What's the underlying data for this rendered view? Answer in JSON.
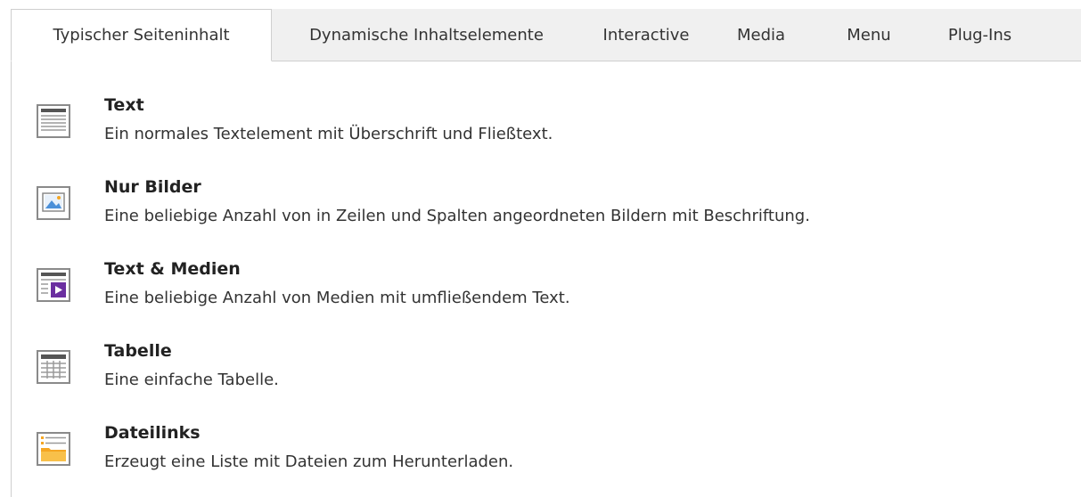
{
  "tabs": [
    {
      "label": "Typischer Seiteninhalt",
      "active": true
    },
    {
      "label": "Dynamische Inhaltselemente",
      "active": false
    },
    {
      "label": "Interactive",
      "active": false
    },
    {
      "label": "Media",
      "active": false
    },
    {
      "label": "Menu",
      "active": false
    },
    {
      "label": "Plug-Ins",
      "active": false
    }
  ],
  "items": [
    {
      "icon": "text-icon",
      "title": "Text",
      "description": "Ein normales Textelement mit Überschrift und Fließtext."
    },
    {
      "icon": "images-icon",
      "title": "Nur Bilder",
      "description": "Eine beliebige Anzahl von in Zeilen und Spalten angeordneten Bildern mit Beschriftung."
    },
    {
      "icon": "text-media-icon",
      "title": "Text & Medien",
      "description": "Eine beliebige Anzahl von Medien mit umfließendem Text."
    },
    {
      "icon": "table-icon",
      "title": "Tabelle",
      "description": "Eine einfache Tabelle."
    },
    {
      "icon": "filelinks-icon",
      "title": "Dateilinks",
      "description": "Erzeugt eine Liste mit Dateien zum Herunterladen."
    }
  ],
  "colors": {
    "icon_gray": "#8a8a8a",
    "sky_blue": "#4a90d9",
    "media_purple": "#6b2fa0",
    "folder_orange": "#f5a623"
  }
}
